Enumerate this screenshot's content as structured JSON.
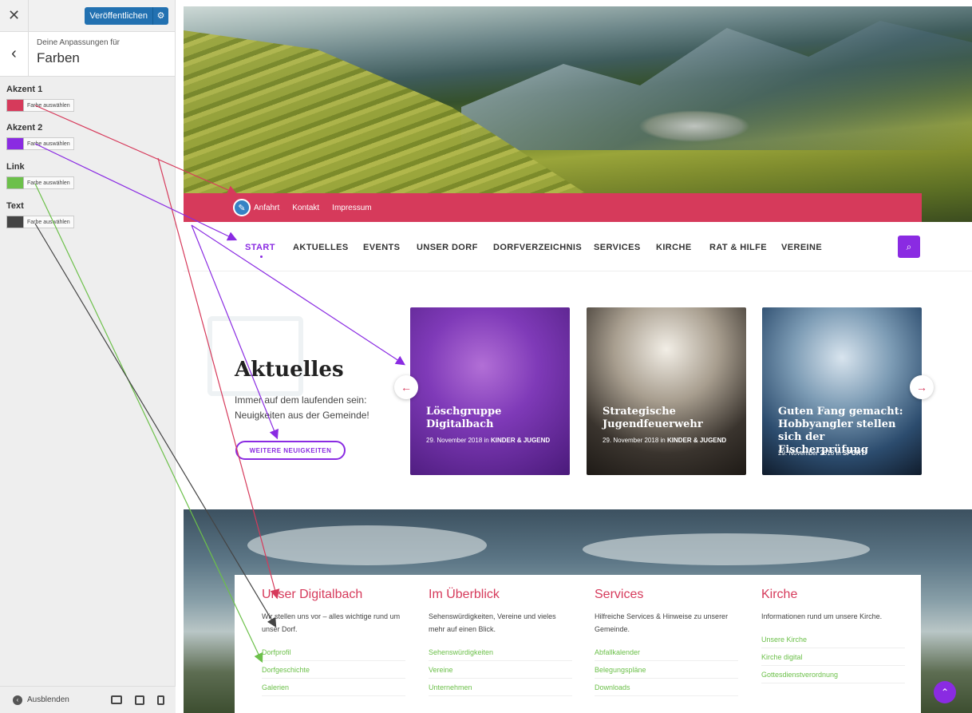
{
  "customizer": {
    "close_icon": "close-icon",
    "publish_label": "Veröffentlichen",
    "subtitle": "Deine Anpassungen für",
    "title": "Farben",
    "colors": [
      {
        "label": "Akzent 1",
        "value": "#d63a5b",
        "button": "Farbe auswählen"
      },
      {
        "label": "Akzent 2",
        "value": "#8a2be2",
        "button": "Farbe auswählen"
      },
      {
        "label": "Link",
        "value": "#6cc04a",
        "button": "Farbe auswählen"
      },
      {
        "label": "Text",
        "value": "#444444",
        "button": "Farbe auswählen"
      }
    ],
    "hide_label": "Ausblenden"
  },
  "site": {
    "top_links": [
      "Anfahrt",
      "Kontakt",
      "Impressum"
    ],
    "nav": [
      "START",
      "AKTUELLES",
      "EVENTS",
      "UNSER DORF",
      "DORFVERZEICHNIS",
      "SERVICES",
      "KIRCHE",
      "RAT & HILFE",
      "VEREINE"
    ],
    "news": {
      "heading": "Aktuelles",
      "intro": "Immer auf dem laufenden sein: Neuigkeiten aus der Gemeinde!",
      "more_button": "WEITERE NEUIGKEITEN"
    },
    "cards": [
      {
        "title": "Löschgruppe Digitalbach",
        "date": "29. November 2018 in",
        "category": "KINDER & JUGEND"
      },
      {
        "title": "Strategische Jugendfeuerwehr",
        "date": "29. November 2018 in",
        "category": "KINDER & JUGEND"
      },
      {
        "title": "Guten Fang gemacht: Hobbyangler stellen sich der Fischerprüfung",
        "date": "29. November 2018 in",
        "category": "SPORT"
      }
    ],
    "columns": [
      {
        "heading": "Unser Digitalbach",
        "desc": "Wir stellen uns vor – alles wichtige rund um unser Dorf.",
        "links": [
          "Dorfprofil",
          "Dorfgeschichte",
          "Galerien"
        ]
      },
      {
        "heading": "Im Überblick",
        "desc": "Sehenswürdigkeiten, Vereine und vieles mehr auf einen Blick.",
        "links": [
          "Sehenswürdigkeiten",
          "Vereine",
          "Unternehmen"
        ]
      },
      {
        "heading": "Services",
        "desc": "Hilfreiche Services & Hinweise zu unserer Gemeinde.",
        "links": [
          "Abfallkalender",
          "Belegungspläne",
          "Downloads"
        ]
      },
      {
        "heading": "Kirche",
        "desc": "Informationen rund um unsere Kirche.",
        "links": [
          "Unsere Kirche",
          "Kirche digital",
          "Gottesdienstverordnung"
        ]
      }
    ]
  },
  "accent_colors": {
    "akzent1": "#d63a5b",
    "akzent2": "#8a2be2",
    "link": "#6cc04a",
    "text": "#444444"
  }
}
